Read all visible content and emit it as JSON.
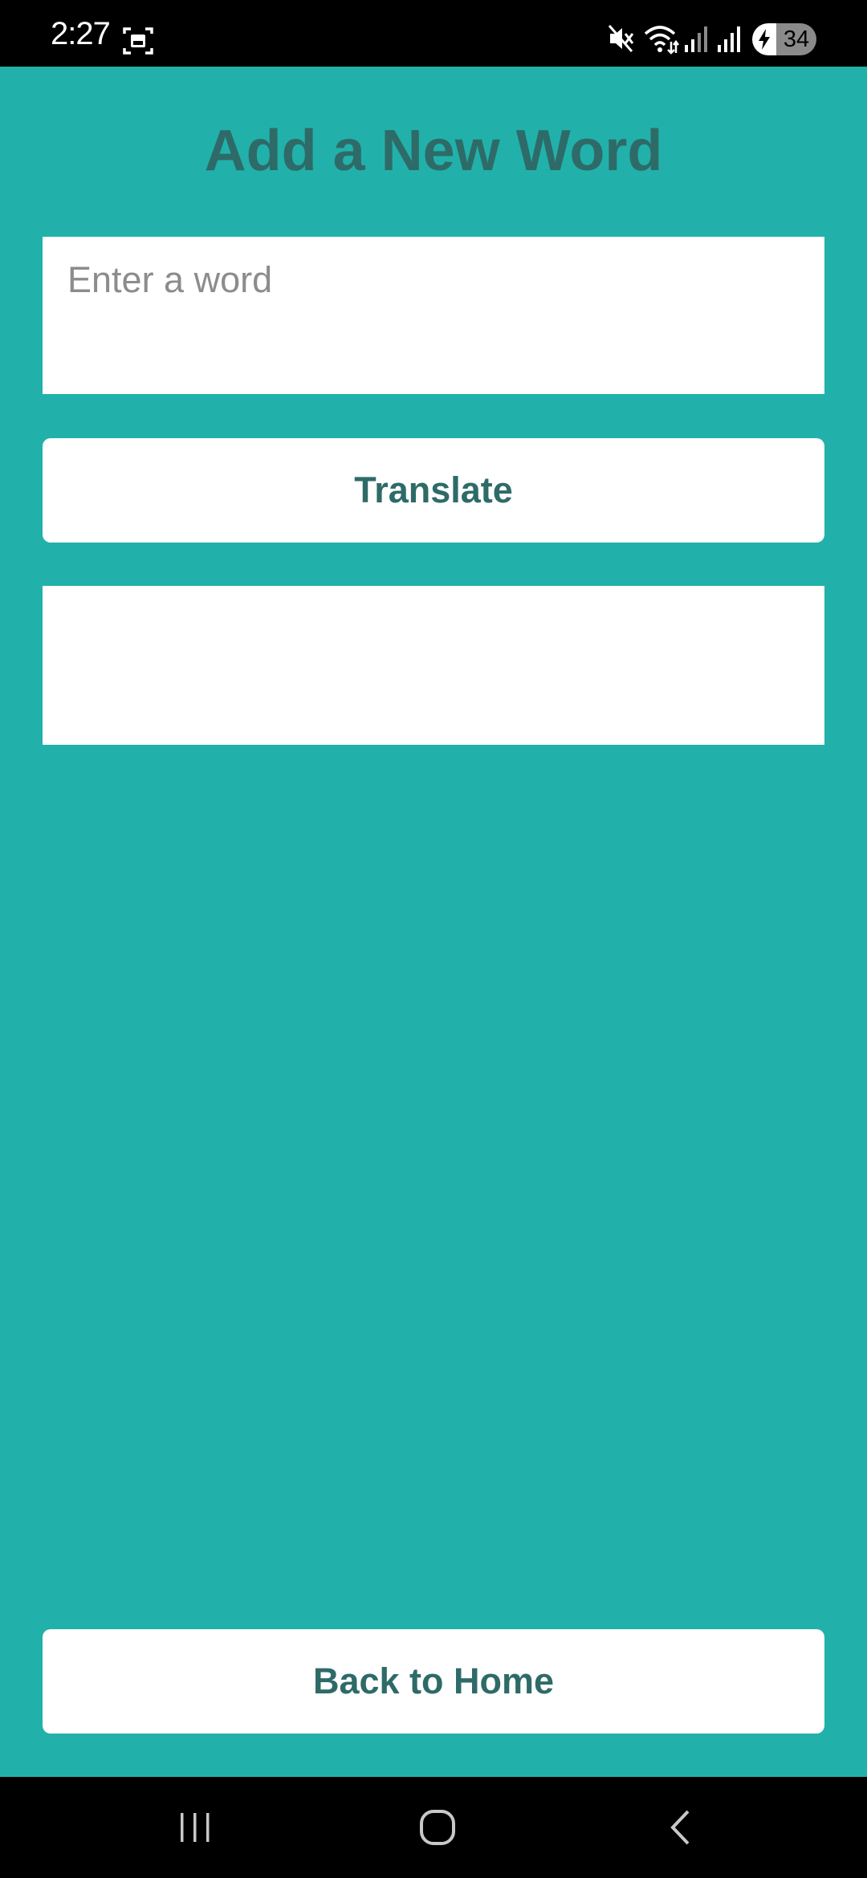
{
  "status_bar": {
    "time": "2:27",
    "battery_level": "34",
    "icons": [
      "screenshot-icon",
      "mute-icon",
      "wifi-icon",
      "signal-icon",
      "signal-icon",
      "battery-charging-icon"
    ]
  },
  "page": {
    "title": "Add a New Word"
  },
  "word_input": {
    "placeholder": "Enter a word",
    "value": ""
  },
  "translate_button": {
    "label": "Translate"
  },
  "translation_result": {
    "text": ""
  },
  "home_button": {
    "label": "Back to Home"
  },
  "nav_bar": {
    "buttons": [
      "recent-apps-icon",
      "home-icon",
      "back-icon"
    ]
  },
  "colors": {
    "background": "#21b1aa",
    "accent_text": "#2e6b68",
    "surface": "#ffffff",
    "system_bars": "#000000"
  }
}
